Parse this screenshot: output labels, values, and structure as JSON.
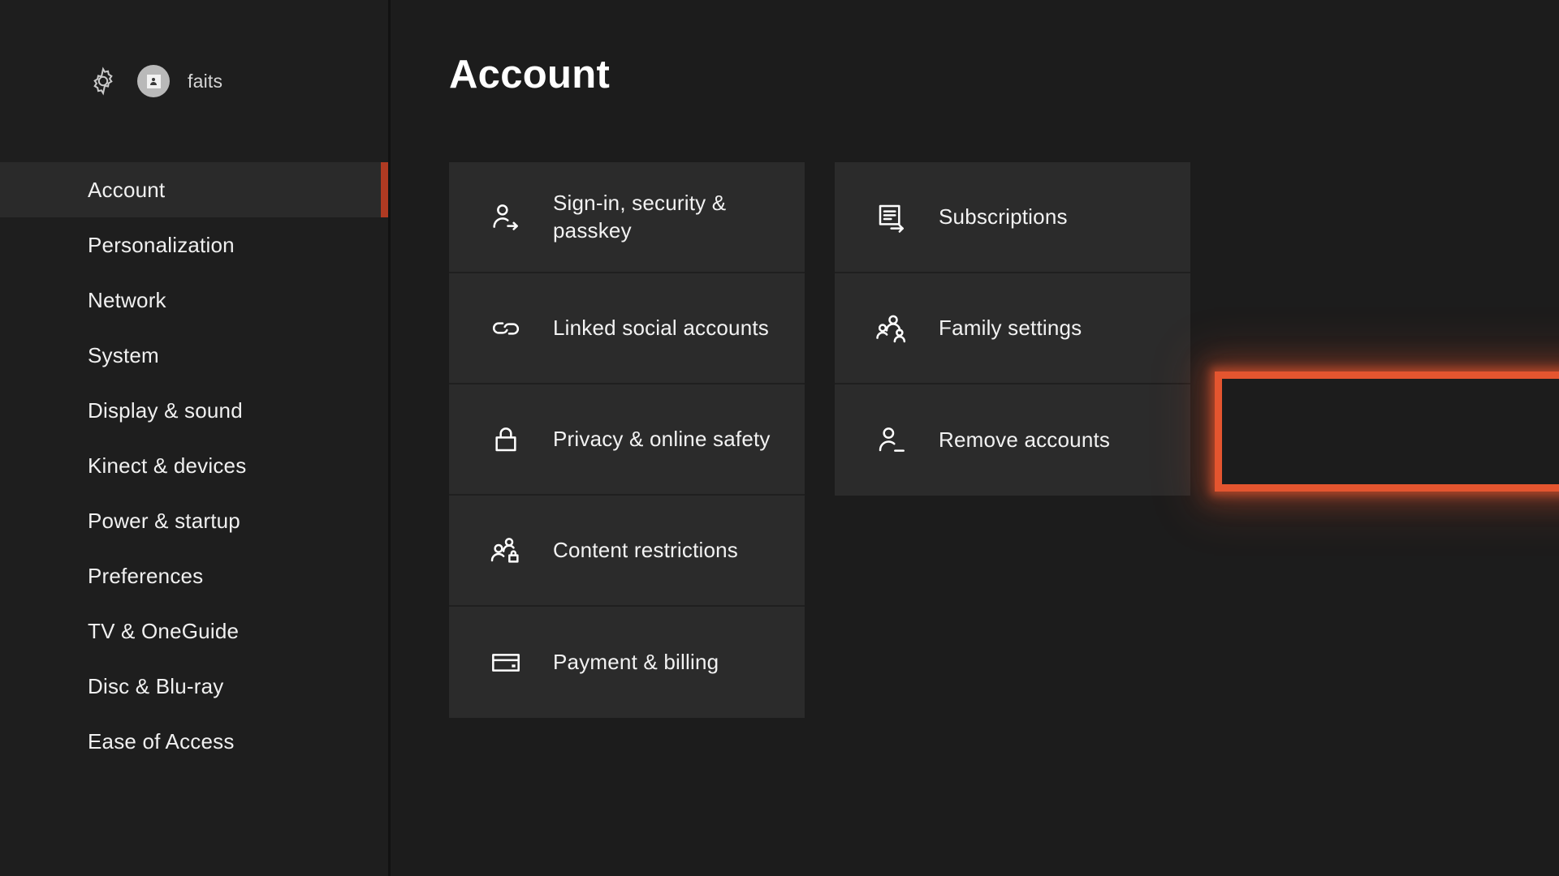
{
  "header": {
    "gear_icon": "gear-icon",
    "avatar_icon": "avatar-gamerpic",
    "profile_name": "faits"
  },
  "sidebar": {
    "items": [
      {
        "label": "Account",
        "selected": true
      },
      {
        "label": "Personalization",
        "selected": false
      },
      {
        "label": "Network",
        "selected": false
      },
      {
        "label": "System",
        "selected": false
      },
      {
        "label": "Display & sound",
        "selected": false
      },
      {
        "label": "Kinect & devices",
        "selected": false
      },
      {
        "label": "Power & startup",
        "selected": false
      },
      {
        "label": "Preferences",
        "selected": false
      },
      {
        "label": "TV & OneGuide",
        "selected": false
      },
      {
        "label": "Disc & Blu-ray",
        "selected": false
      },
      {
        "label": "Ease of Access",
        "selected": false
      }
    ]
  },
  "main": {
    "title": "Account",
    "column_left": [
      {
        "label": "Sign-in, security & passkey",
        "icon": "person-arrow-icon"
      },
      {
        "label": "Linked social accounts",
        "icon": "link-chain-icon"
      },
      {
        "label": "Privacy & online safety",
        "icon": "padlock-icon"
      },
      {
        "label": "Content restrictions",
        "icon": "people-lock-icon"
      },
      {
        "label": "Payment & billing",
        "icon": "credit-card-icon"
      }
    ],
    "column_right": [
      {
        "label": "Subscriptions",
        "icon": "document-arrow-icon"
      },
      {
        "label": "Family settings",
        "icon": "people-group-icon"
      },
      {
        "label": "Remove accounts",
        "icon": "person-minus-icon"
      }
    ]
  },
  "highlight": {
    "target_label": "Remove accounts",
    "border_color": "#e4552f",
    "glow_color": "#e4552f"
  },
  "colors": {
    "page_background": "#1c1c1c",
    "sidebar_background": "#1e1e1e",
    "tile_background": "#2b2b2b",
    "selected_nav_background": "#2a2a2a",
    "nav_accent": "#b03a22",
    "text_primary": "#f2f2f2"
  }
}
